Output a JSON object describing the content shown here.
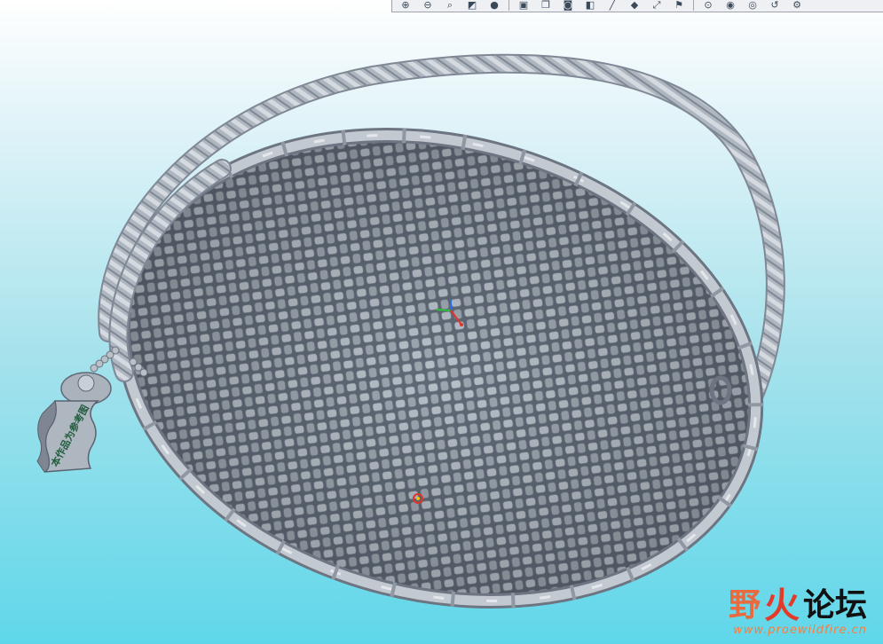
{
  "toolbar": {
    "icons": [
      {
        "name": "zoom-in-icon",
        "glyph": "⊕"
      },
      {
        "name": "zoom-out-icon",
        "glyph": "⊖"
      },
      {
        "name": "refit-icon",
        "glyph": "⌕"
      },
      {
        "name": "reorient-icon",
        "glyph": "◩"
      },
      {
        "name": "shading-icon",
        "glyph": "●"
      },
      {
        "name": "saved-views-icon",
        "glyph": "▣"
      },
      {
        "name": "layers-icon",
        "glyph": "❐"
      },
      {
        "name": "camera-icon",
        "glyph": "◙"
      },
      {
        "name": "datum-planes-icon",
        "glyph": "◧"
      },
      {
        "name": "datum-axes-icon",
        "glyph": "╱"
      },
      {
        "name": "datum-points-icon",
        "glyph": "◆"
      },
      {
        "name": "csys-icon",
        "glyph": "⤢"
      },
      {
        "name": "annotations-icon",
        "glyph": "⚑"
      },
      {
        "name": "spin-center-icon",
        "glyph": "⊙"
      },
      {
        "name": "visibility-icon",
        "glyph": "◉"
      },
      {
        "name": "eye-icon",
        "glyph": "◎"
      },
      {
        "name": "regen-icon",
        "glyph": "↺"
      },
      {
        "name": "settings-icon",
        "glyph": "⚙"
      }
    ]
  },
  "model": {
    "tag_text": "本作品为参考图",
    "colors": {
      "metal": "#a9b1bb",
      "metal_dark": "#6b7480",
      "metal_light": "#dfe3e8",
      "axis_x": "#e0332c",
      "axis_y": "#2fbf3a",
      "axis_z": "#2d6ee6"
    }
  },
  "watermark": {
    "title_part1": "野",
    "title_part2": "火",
    "title_part3": "论坛",
    "url": "www.proewildfire.cn"
  }
}
